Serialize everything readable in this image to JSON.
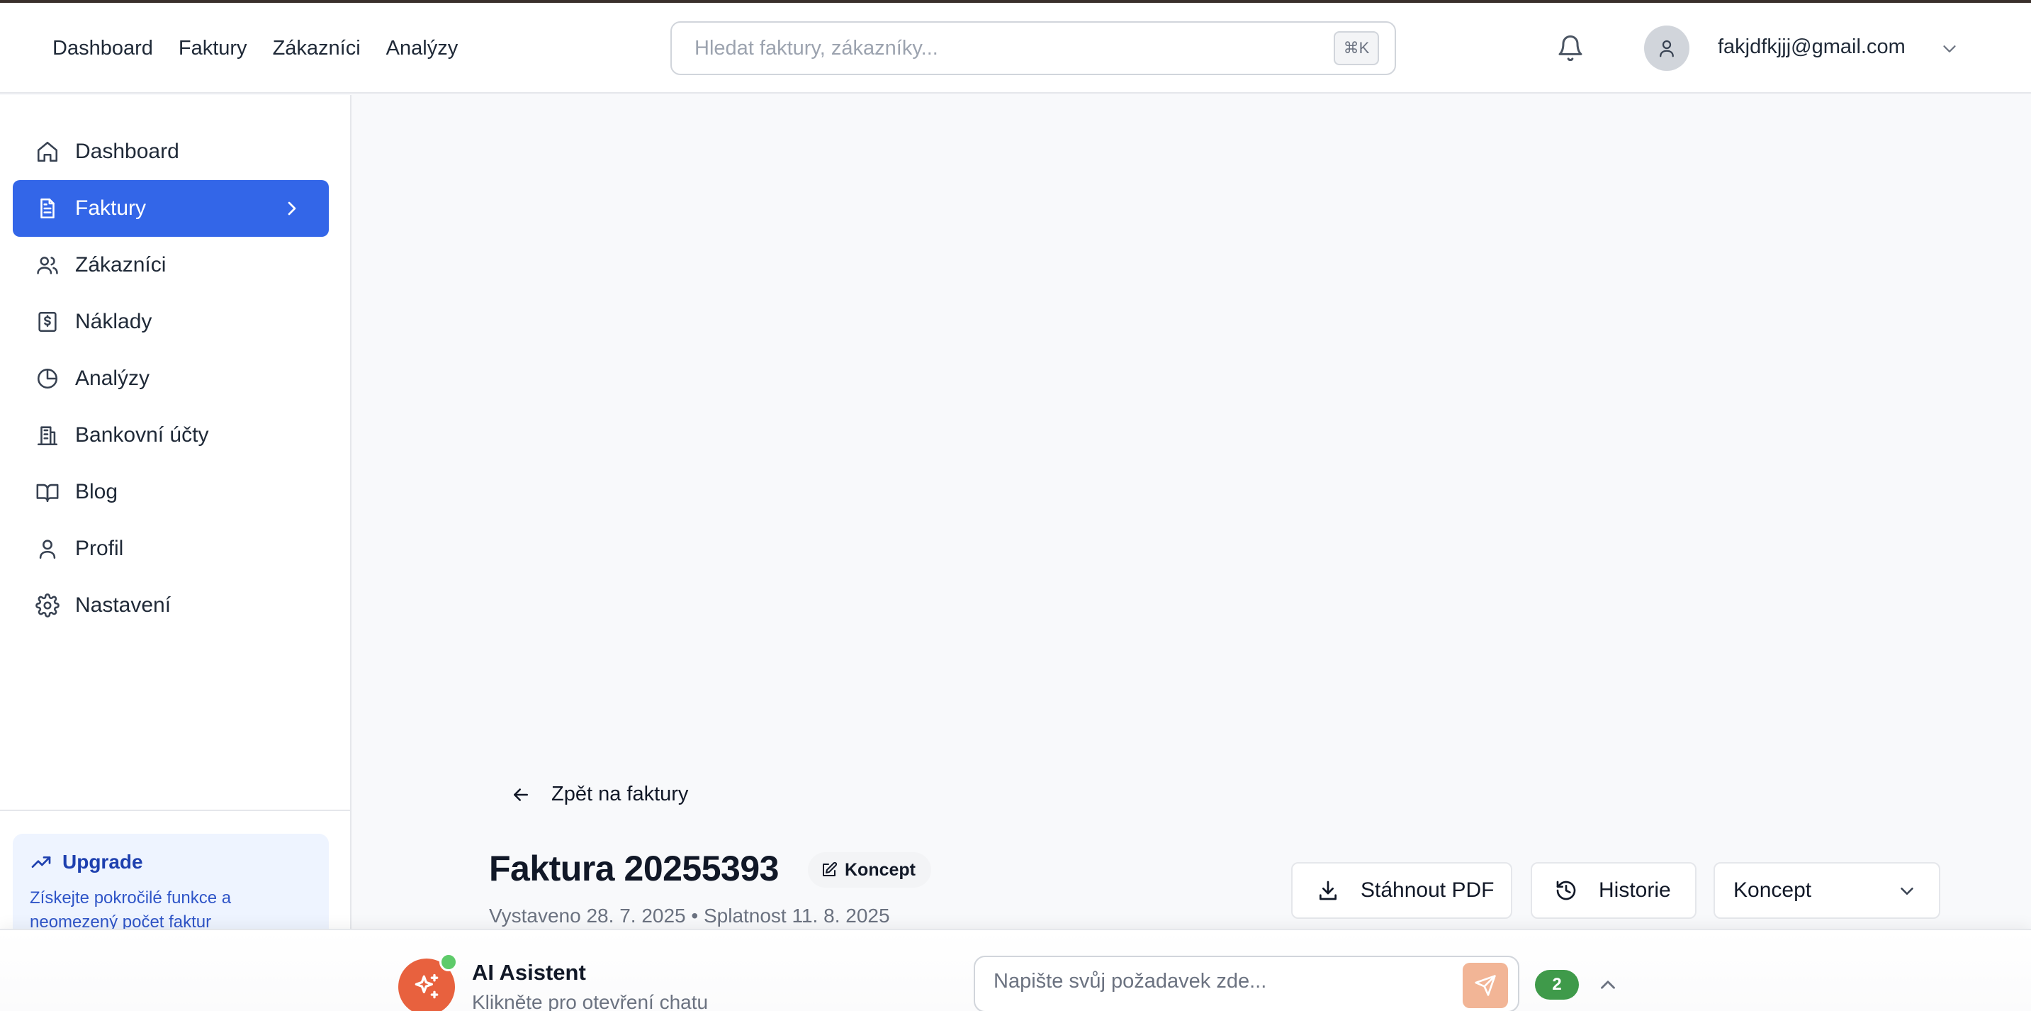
{
  "topnav": {
    "items": [
      "Dashboard",
      "Faktury",
      "Zákazníci",
      "Analýzy"
    ]
  },
  "search": {
    "placeholder": "Hledat faktury, zákazníky...",
    "shortcut": "⌘K"
  },
  "user": {
    "email": "fakjdfkjjj@gmail.com"
  },
  "sidebar": {
    "items": [
      {
        "label": "Dashboard",
        "icon": "home-icon"
      },
      {
        "label": "Faktury",
        "icon": "file-text-icon",
        "active": true
      },
      {
        "label": "Zákazníci",
        "icon": "users-icon"
      },
      {
        "label": "Náklady",
        "icon": "receipt-dollar-icon"
      },
      {
        "label": "Analýzy",
        "icon": "pie-chart-icon"
      },
      {
        "label": "Bankovní účty",
        "icon": "bank-building-icon"
      },
      {
        "label": "Blog",
        "icon": "book-open-icon"
      },
      {
        "label": "Profil",
        "icon": "user-icon"
      },
      {
        "label": "Nastavení",
        "icon": "gear-icon"
      }
    ],
    "upgrade": {
      "title": "Upgrade",
      "description": "Získejte pokročilé funkce a neomezený počet faktur"
    }
  },
  "invoice": {
    "back_label": "Zpět na faktury",
    "title": "Faktura 20255393",
    "status_badge": "Koncept",
    "dates": "Vystaveno 28. 7. 2025 • Splatnost 11. 8. 2025",
    "download_label": "Stáhnout PDF",
    "history_label": "Historie",
    "status_select": "Koncept"
  },
  "ai": {
    "title": "AI Asistent",
    "subtitle": "Klikněte pro otevření chatu",
    "input_placeholder": "Napište svůj požadavek zde...",
    "count": "2"
  },
  "colors": {
    "accent": "#3366e8",
    "ai_orange": "#e8613e",
    "online_green": "#5ecb6a",
    "count_green": "#3f9a4a"
  }
}
